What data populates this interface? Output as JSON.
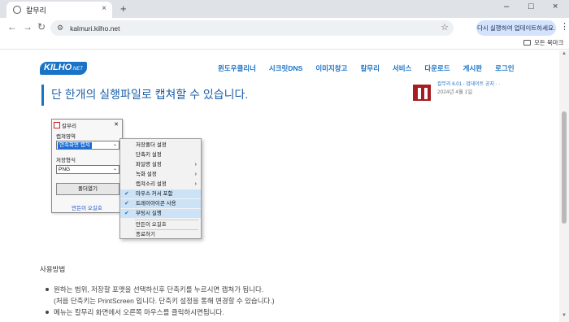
{
  "browser": {
    "tab_title": "칼무리",
    "tab_close": "×",
    "new_tab": "+",
    "url": "kalmuri.kilho.net",
    "update_button": "다시 실행하여 업데이트하세요.",
    "all_bookmarks": "모든 북마크",
    "window_controls": [
      "–",
      "□",
      "×"
    ]
  },
  "site": {
    "logo": "KILHO",
    "logo_suffix": ".NET",
    "nav": [
      "윈도우클리너",
      "시크릿DNS",
      "이미지창고",
      "칼무리",
      "서비스",
      "다운로드",
      "게시판",
      "로그인"
    ],
    "headline": "단 한개의 실행파일로 캡쳐할 수 있습니다.",
    "sidebar_partial_title": "칼무리 6.01 - 업데이트 공지 · ·",
    "sidebar_date": "2024년 4월 1일"
  },
  "app_window": {
    "title": "칼무리",
    "capture_area_label": "캡쳐영역",
    "capture_area_value": "연속화면 캡쳐",
    "save_format_label": "저장형식",
    "save_format_value": "PNG",
    "folder_button": "폴더열기",
    "author_link": "만든이 오길호"
  },
  "context_menu": {
    "items": [
      {
        "label": "저장폴더 설정",
        "checked": false,
        "submenu": false
      },
      {
        "label": "단축키 설정",
        "checked": false,
        "submenu": false
      },
      {
        "label": "파일명 설정",
        "checked": false,
        "submenu": true
      },
      {
        "label": "녹화 설정",
        "checked": false,
        "submenu": true
      },
      {
        "label": "캡쳐소리 설정",
        "checked": false,
        "submenu": true
      },
      {
        "label": "마우스 커서 포함",
        "checked": true,
        "submenu": false
      },
      {
        "label": "트레이아이콘 사용",
        "checked": true,
        "submenu": false
      },
      {
        "label": "부팅시 실행",
        "checked": true,
        "submenu": false
      },
      {
        "label": "만든이 오길호",
        "checked": false,
        "submenu": false
      },
      {
        "label": "종료하기",
        "checked": false,
        "submenu": false
      }
    ]
  },
  "article": {
    "usage_heading": "사용방법",
    "bullet1": "원하는 범위, 저장할 포맷을 선택하신후 단축키를 누르시면 캡쳐가 됩니다.",
    "bullet1_cont": "(처음 단축키는 PrintScreen 입니다. 단축키 설정을 통해 변경할 수 있습니다.)",
    "bullet2": "메뉴는 칼무리 화면에서 오른쪽 마우스를 클릭하시면됩니다."
  },
  "colors": {
    "accent": "#1a73c7",
    "menu_highlight": "#cce3f7",
    "update_button_bg": "#d3e3fd"
  }
}
